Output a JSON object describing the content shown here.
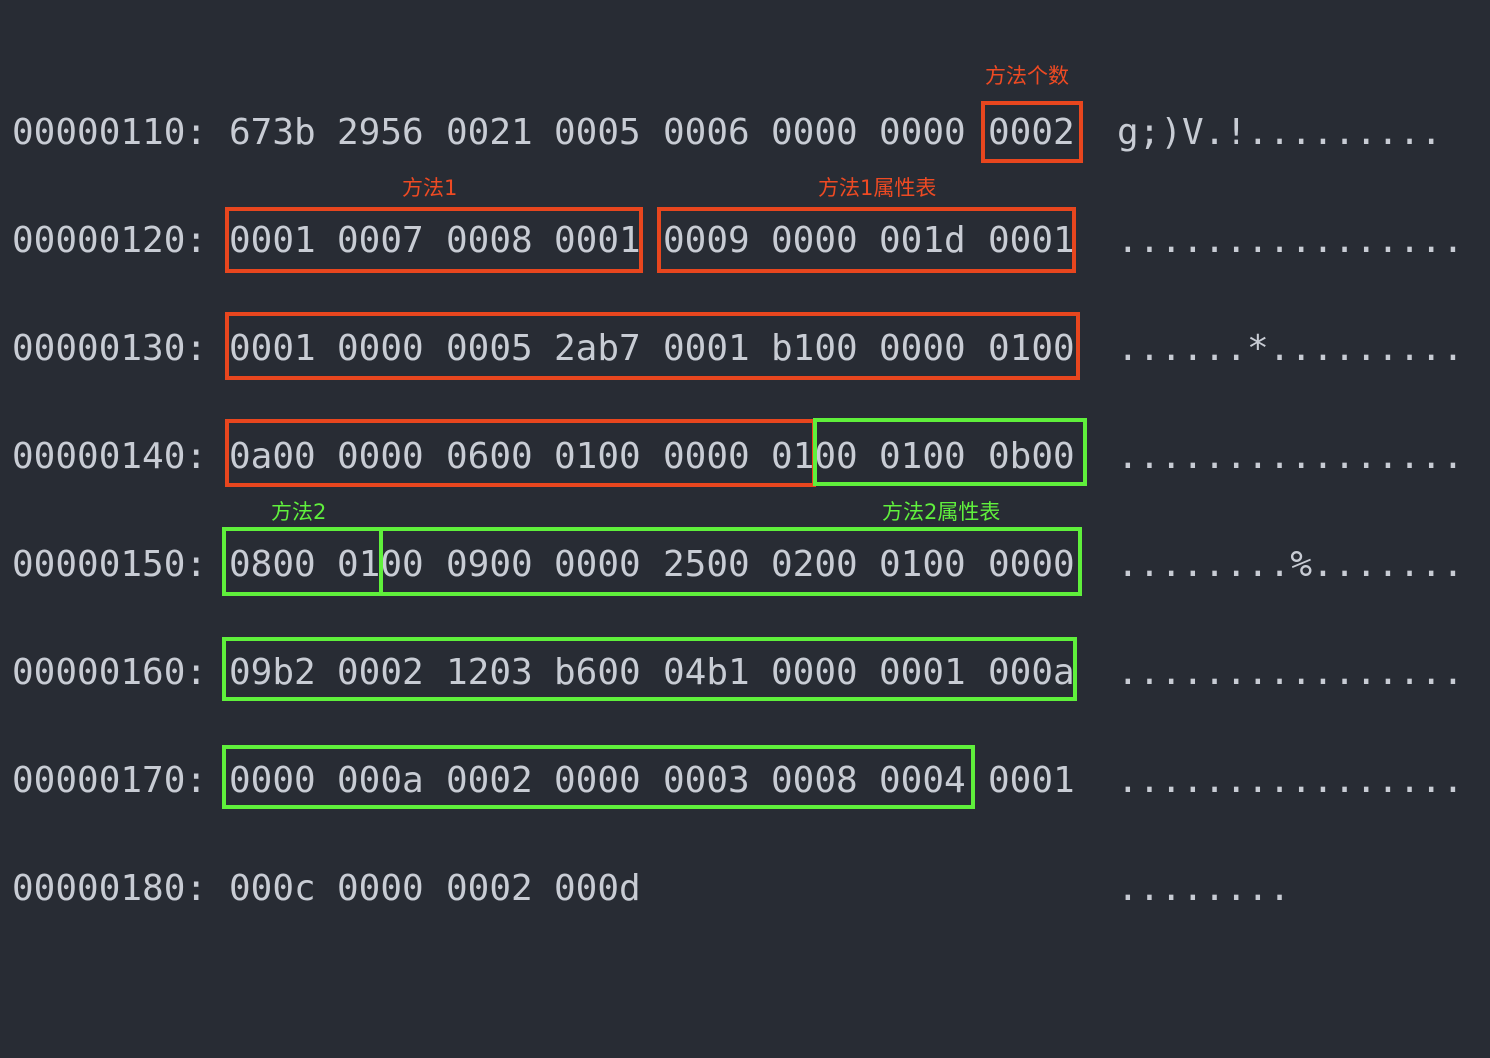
{
  "hexdump": {
    "rows": [
      {
        "addr": "00000110:",
        "words": [
          "673b",
          "2956",
          "0021",
          "0005",
          "0006",
          "0000",
          "0000",
          "0002"
        ],
        "ascii": "g;)V.!........."
      },
      {
        "addr": "00000120:",
        "words": [
          "0001",
          "0007",
          "0008",
          "0001",
          "0009",
          "0000",
          "001d",
          "0001"
        ],
        "ascii": "................"
      },
      {
        "addr": "00000130:",
        "words": [
          "0001",
          "0000",
          "0005",
          "2ab7",
          "0001",
          "b100",
          "0000",
          "0100"
        ],
        "ascii": "......*........."
      },
      {
        "addr": "00000140:",
        "words": [
          "0a00",
          "0000",
          "0600",
          "0100",
          "0000",
          "0100",
          "0100",
          "0b00"
        ],
        "ascii": "................"
      },
      {
        "addr": "00000150:",
        "words": [
          "0800",
          "0100",
          "0900",
          "0000",
          "2500",
          "0200",
          "0100",
          "0000"
        ],
        "ascii": "........%......."
      },
      {
        "addr": "00000160:",
        "words": [
          "09b2",
          "0002",
          "1203",
          "b600",
          "04b1",
          "0000",
          "0001",
          "000a"
        ],
        "ascii": "................"
      },
      {
        "addr": "00000170:",
        "words": [
          "0000",
          "000a",
          "0002",
          "0000",
          "0003",
          "0008",
          "0004",
          "0001"
        ],
        "ascii": "................"
      },
      {
        "addr": "00000180:",
        "words": [
          "000c",
          "0000",
          "0002",
          "000d"
        ],
        "ascii": "........"
      }
    ]
  },
  "annotations": {
    "method_count": "方法个数",
    "method1": "方法1",
    "method1_attrs": "方法1属性表",
    "method2": "方法2",
    "method2_attrs": "方法2属性表"
  },
  "colors": {
    "background": "#282c34",
    "text": "#c8ccd4",
    "red": "#e8461e",
    "green": "#5ff03b"
  }
}
